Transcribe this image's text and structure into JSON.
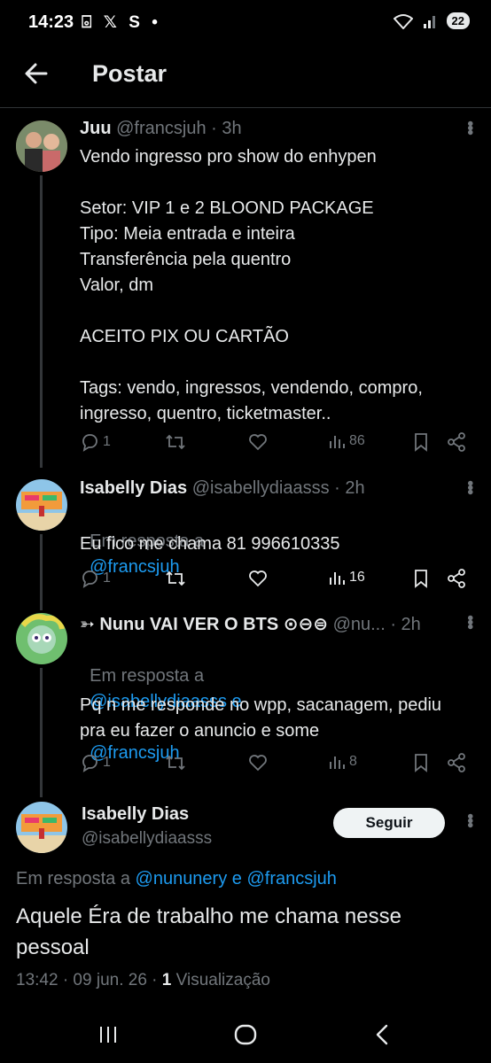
{
  "status": {
    "time": "14:23",
    "left_icons": "⌻ 𝕏 S •",
    "battery": "22"
  },
  "header": {
    "title": "Postar"
  },
  "tweets": [
    {
      "name": "Juu",
      "handle": "@francsjuh",
      "time": "· 3h",
      "body": "Vendo ingresso pro show do enhypen\n\nSetor: VIP 1 e 2 BLOOND PACKAGE\nTipo: Meia entrada e inteira\nTransferência pela quentro\nValor, dm\n\nACEITO PIX OU CARTÃO\n\nTags: vendo, ingressos, vendendo, compro,\ningresso, quentro, ticketmaster..",
      "replies": "1",
      "views": "86"
    },
    {
      "name": "Isabelly Dias",
      "handle": "@isabellydiaasss",
      "time": "· 2h",
      "reply_prefix": "Em resposta a",
      "reply_to": "@francsjuh",
      "body": "Eu fico me chama 81 996610335",
      "replies": "1",
      "views": "16"
    },
    {
      "name": "➳ Nunu VAI VER O BTS ⊙⊖⊜",
      "handle": "@nu...",
      "time": "· 2h",
      "reply_prefix": "Em resposta a",
      "reply_to": "@isabellydiaasss e",
      "reply_to_2": "@francsjuh",
      "body": "Pq n me responde no wpp, sacanagem, pediu\npra eu fazer o anuncio e some",
      "replies": "1",
      "views": "8"
    }
  ],
  "main_tweet": {
    "name": "Isabelly Dias",
    "handle": "@isabellydiaasss",
    "follow_label": "Seguir",
    "reply_prefix": "Em resposta a",
    "reply_to": "@nununery e @francsjuh",
    "body": "Aquele Éra de trabalho me chama nesse\npessoal",
    "timestamp": "13:42 · 09 jun. 26 ·",
    "views_count": "1",
    "views_label": "Visualização"
  },
  "colors": {
    "background": "#000000",
    "link": "#1d9bf0",
    "muted": "#71767b",
    "divider": "#2f3336"
  }
}
